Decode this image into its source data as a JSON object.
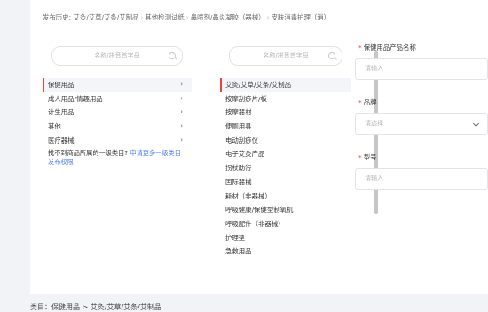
{
  "history": {
    "label": "发布历史:",
    "items": [
      "艾灸/艾草/艾条/艾制品",
      "其他检测试纸",
      "鼻喷剂/鼻炎凝胶（器械）",
      "皮肤消毒护理（消）"
    ],
    "separator": "›"
  },
  "col1": {
    "search_placeholder": "名称/拼音首字母",
    "items": [
      {
        "label": "保健用品",
        "arrow": "›"
      },
      {
        "label": "成人用品/情趣用品",
        "arrow": "›"
      },
      {
        "label": "计生用品",
        "arrow": "›"
      },
      {
        "label": "其他",
        "arrow": "›"
      },
      {
        "label": "医疗器械",
        "arrow": "›"
      }
    ],
    "note_text": "找不到商品所属的一级类目?",
    "note_link": "申请更多一级类目发布权限"
  },
  "col2": {
    "search_placeholder": "名称/拼音首字母",
    "items": [
      "艾灸/艾草/艾条/艾制品",
      "按摩刮痧片/板",
      "按摩器材",
      "便厕用具",
      "电动刮痧仪",
      "电子艾灸产品",
      "拐杖助行",
      "国际器械",
      "耗材（非器械）",
      "呼吸健康/保健型制氧机",
      "呼吸配件（非器械）",
      "护理垫",
      "急救用品"
    ]
  },
  "form": {
    "product_name_label": "保健用品产品名称",
    "product_name_placeholder": "请输入",
    "brand_label": "品牌",
    "brand_placeholder": "请选择",
    "model_label": "型号",
    "model_placeholder": "请输入",
    "required_mark": "*"
  },
  "bottom": {
    "text": "类目：保健用品 > 艾灸/艾草/艾条/艾制品"
  },
  "colors": {
    "accent": "#e8453c",
    "link": "#4b7bec"
  }
}
